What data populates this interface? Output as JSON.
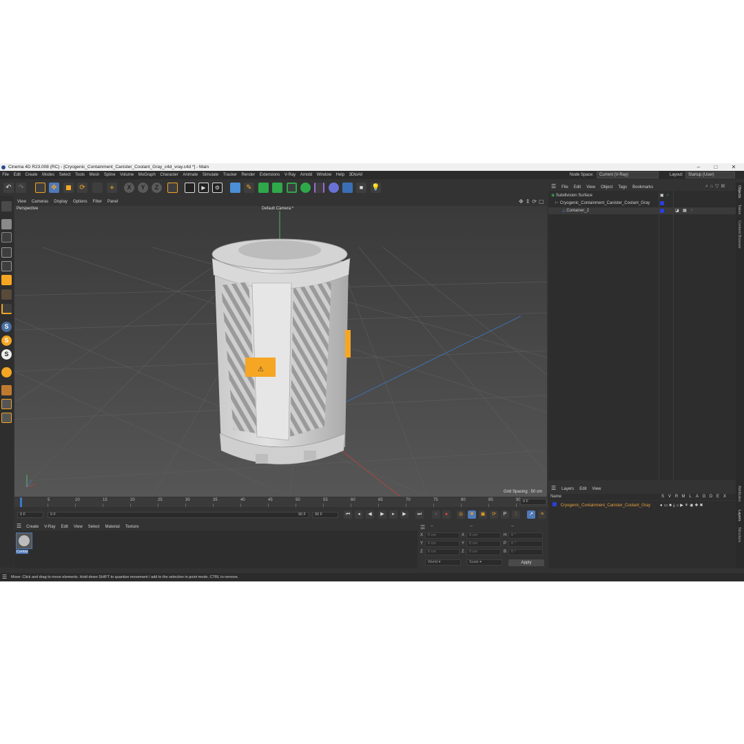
{
  "window": {
    "title": "Cinema 4D R23.008 (RC) - [Cryogenic_Containment_Canister_Coolant_Gray_c4d_vray.c4d *] - Main",
    "min": "–",
    "max": "□",
    "close": "✕"
  },
  "menubar": {
    "items": [
      "File",
      "Edit",
      "Create",
      "Modes",
      "Select",
      "Tools",
      "Mesh",
      "Spline",
      "Volume",
      "MoGraph",
      "Character",
      "Animate",
      "Simulate",
      "Tracker",
      "Render",
      "Extensions",
      "V-Ray",
      "Arnold",
      "Window",
      "Help",
      "3DtoAll"
    ],
    "node_space_label": "Node Space:",
    "node_space_value": "Current (V-Ray)",
    "layout_label": "Layout:",
    "layout_value": "Startup (User)"
  },
  "viewport": {
    "menu": [
      "View",
      "Cameras",
      "Display",
      "Options",
      "Filter",
      "Panel"
    ],
    "view_name": "Perspective",
    "camera_name": "Default Camera",
    "camera_suffix": ":*",
    "grid_spacing": "Grid Spacing : 50 cm",
    "nav_icons": [
      "move-view-icon",
      "zoom-view-icon",
      "rotate-view-icon",
      "maximize-view-icon"
    ]
  },
  "timeline": {
    "ticks": [
      "0",
      "5",
      "10",
      "15",
      "20",
      "25",
      "30",
      "35",
      "40",
      "45",
      "50",
      "55",
      "60",
      "65",
      "70",
      "75",
      "80",
      "85",
      "90"
    ],
    "current_frame_right": "0 F",
    "start_frame": "0 F",
    "start_frame2": "0 F",
    "end_frame": "90 F",
    "end_frame2": "90 F"
  },
  "materials": {
    "menu": [
      "Create",
      "V-Ray",
      "Edit",
      "View",
      "Select",
      "Material",
      "Texture"
    ],
    "items": [
      {
        "name": "Contai"
      }
    ]
  },
  "coords": {
    "rows": [
      {
        "a": "X",
        "av": "0 cm",
        "b": "X",
        "bv": "0 cm",
        "c": "H",
        "cv": "0 °"
      },
      {
        "a": "Y",
        "av": "0 cm",
        "b": "Y",
        "bv": "0 cm",
        "c": "P",
        "cv": "0 °"
      },
      {
        "a": "Z",
        "av": "0 cm",
        "b": "Z",
        "bv": "0 cm",
        "c": "B",
        "cv": "0 °"
      }
    ],
    "mode": "World",
    "scale": "Scale",
    "apply": "Apply",
    "dash1": "--",
    "dash2": "--",
    "dash3": "--"
  },
  "objects": {
    "menu": [
      "File",
      "Edit",
      "View",
      "Object",
      "Tags",
      "Bookmarks"
    ],
    "rows": [
      {
        "name": "Subdivision Surface",
        "indent": 0
      },
      {
        "name": "Cryogenic_Containment_Canister_Coolant_Gray",
        "indent": 1
      },
      {
        "name": "Container_2",
        "indent": 2
      }
    ]
  },
  "layers": {
    "menu": [
      "Layers",
      "Edit",
      "View"
    ],
    "name_header": "Name",
    "cols": [
      "S",
      "V",
      "R",
      "M",
      "L",
      "A",
      "G",
      "D",
      "E",
      "X"
    ],
    "rows": [
      {
        "name": "Cryogenic_Containment_Canister_Coolant_Gray"
      }
    ]
  },
  "side_tabs": [
    "Objects",
    "Takes",
    "Content Browser",
    "Attributes",
    "Layers",
    "Structure"
  ],
  "status": "Move: Click and drag to move elements. Hold down SHIFT to quantize movement / add to the selection in point mode, CTRL to remove.",
  "colors": {
    "accent_orange": "#f5a623",
    "selection_blue": "#3b6fb5",
    "layer_color": "#2a3fd6",
    "object_name_orange": "#e8a040"
  }
}
